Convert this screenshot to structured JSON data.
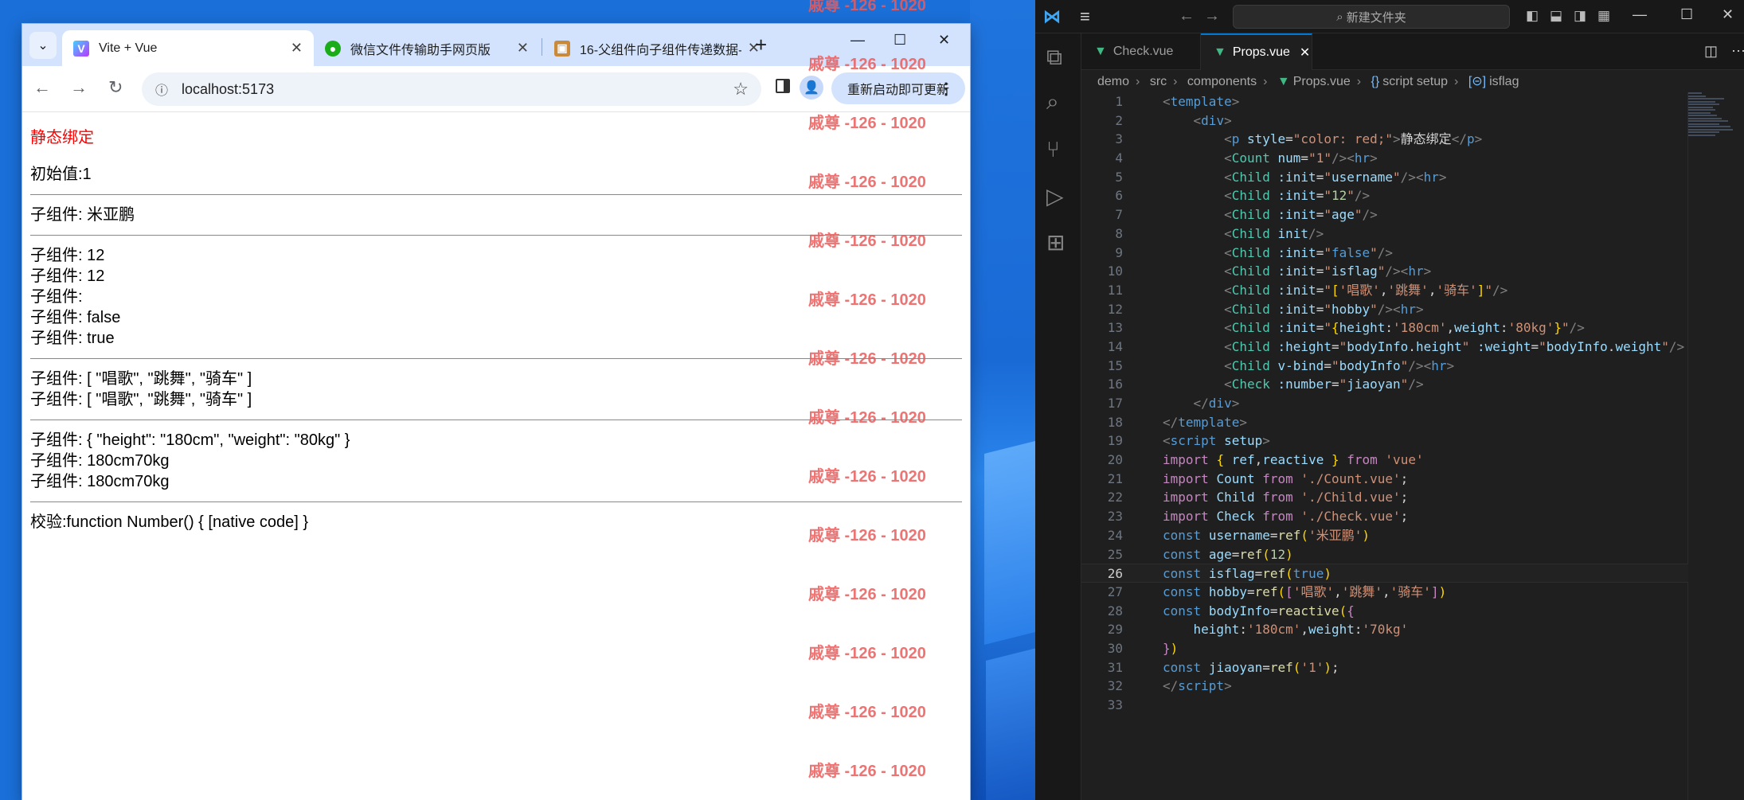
{
  "browser": {
    "tabs": [
      {
        "title": "Vite + Vue",
        "icon": "vite-icon",
        "active": true
      },
      {
        "title": "微信文件传输助手网页版",
        "icon": "wechat-icon",
        "active": false
      },
      {
        "title": "16-父组件向子组件传递数据-",
        "icon": "article-icon",
        "active": false
      }
    ],
    "url": "localhost:5173",
    "update_label": "重新启动即可更新",
    "page": {
      "title": "静态绑定",
      "initial": "初始值:1",
      "child_username": "子组件: 米亚鹏",
      "group2": [
        "子组件: 12",
        "子组件: 12",
        "子组件:",
        "子组件: false",
        "子组件: true"
      ],
      "group3": [
        "子组件: [ \"唱歌\", \"跳舞\", \"骑车\" ]",
        "子组件: [ \"唱歌\", \"跳舞\", \"骑车\" ]"
      ],
      "group4": [
        "子组件: { \"height\": \"180cm\", \"weight\": \"80kg\" }",
        "子组件: 180cm70kg",
        "子组件: 180cm70kg"
      ],
      "check": "校验:function Number() { [native code] }"
    }
  },
  "watermark": "戚尊 -126 - 1020",
  "vscode": {
    "search_placeholder": "新建文件夹",
    "tabs": [
      {
        "label": "Check.vue",
        "active": false
      },
      {
        "label": "Props.vue",
        "active": true
      }
    ],
    "breadcrumb": [
      "demo",
      "src",
      "components",
      "Props.vue",
      "script setup",
      "isflag"
    ],
    "current_line": 26,
    "line_numbers": [
      "1",
      "2",
      "3",
      "4",
      "5",
      "6",
      "7",
      "8",
      "9",
      "10",
      "11",
      "12",
      "13",
      "14",
      "15",
      "16",
      "17",
      "18",
      "19",
      "20",
      "21",
      "22",
      "23",
      "24",
      "25",
      "26",
      "27",
      "28",
      "29",
      "30",
      "31",
      "32",
      "33"
    ]
  },
  "colors": {
    "red_text": "#ff0000",
    "watermark": "#eb5a5a",
    "vscode_bg": "#1f1f1f",
    "vue_green": "#41b883",
    "accent": "#0078d4"
  }
}
